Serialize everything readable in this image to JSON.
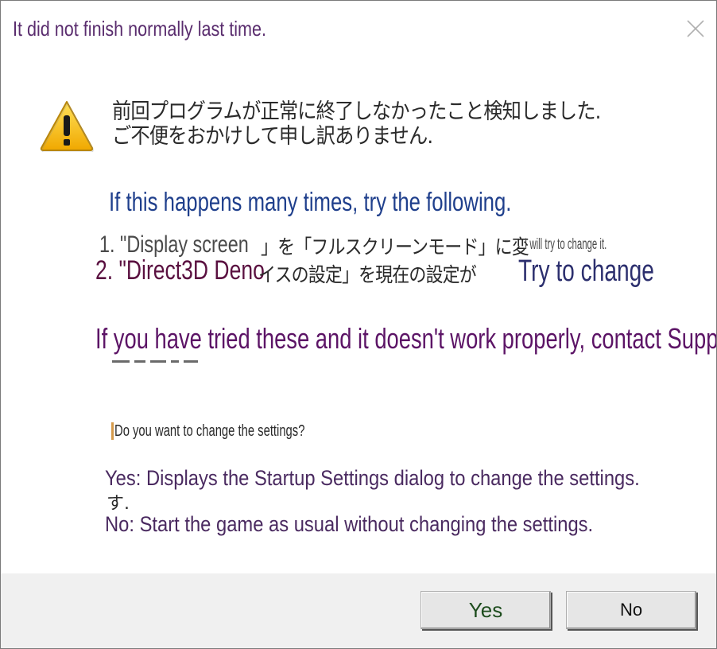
{
  "dialog": {
    "title": "It did not finish normally last time.",
    "close_icon": "close-icon"
  },
  "message": {
    "warning_icon": "warning-icon",
    "jp_line1": "前回プログラムが正常に終了しなかったこと検知しました.",
    "jp_line2": "ご不便をおかけして申し訳ありません.",
    "happens": "If this happens many times, try the following.",
    "item1": "1. \"Display screen",
    "item1_jp": "」を「フルスクリーンモード」に変",
    "item1_tail": "I will try to change it.",
    "item2": "2. \"Direct3D Deno",
    "item2_jp": "イスの設定」を現在の設定が",
    "item2_tail": "Try to change",
    "support": "If you have tried these and it doesn't work properly, contact Support",
    "question": "Do you want to change the settings?",
    "yes_desc": "Yes: Displays the Startup Settings dialog to change the settings.",
    "yes_jp_residue": "す.",
    "no_desc": "No: Start the game as usual without changing the settings."
  },
  "buttons": {
    "yes_label": "Yes",
    "no_label": "No"
  },
  "colors": {
    "title": "#5a2d6e",
    "blue_text": "#1f3f8c",
    "purple_text": "#5c1466",
    "footer_bg": "#f0f0f0",
    "warning_yellow": "#f5c518"
  }
}
